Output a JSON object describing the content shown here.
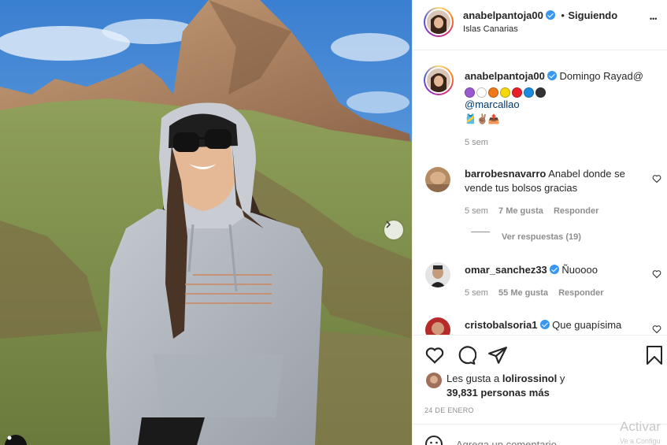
{
  "post": {
    "username": "anabelpantoja00",
    "following_label": "Siguiendo",
    "follow_sep": "•",
    "location": "Islas Canarias",
    "more_label": "•••"
  },
  "caption": {
    "username": "anabelpantoja00",
    "text": "Domingo Rayad@",
    "mention": "@marcallao",
    "emoji_line2": "🎽✌🏽📤",
    "color_circles": [
      "#9b59d0",
      "#ffffff",
      "#f07818",
      "#f5d90c",
      "#e8202a",
      "#1b8ae0",
      "#333333"
    ],
    "time": "5 sem"
  },
  "comments": [
    {
      "username": "barrobesnavarro",
      "text": "Anabel donde se vende tus bolsos gracias",
      "time": "5 sem",
      "likes": "7 Me gusta",
      "reply": "Responder",
      "view_replies": "Ver respuestas (19)"
    },
    {
      "username": "omar_sanchez33",
      "text": "Ñuoooo",
      "time": "5 sem",
      "likes": "55 Me gusta",
      "reply": "Responder"
    },
    {
      "username": "cristobalsoria1",
      "text": "Que guapísima"
    }
  ],
  "likes": {
    "prefix": "Les gusta a",
    "user": "lolirossinol",
    "suffix": "y",
    "others": "39,831 personas más"
  },
  "date": "24 DE ENERO",
  "add_comment_placeholder": "Agrega un comentario...",
  "watermark": {
    "line1": "Activar",
    "line2": "Ve a Configu"
  },
  "icons": {
    "next": "chevron-right-icon",
    "tag": "user-tag-icon",
    "like": "heart-icon",
    "comment": "comment-icon",
    "share": "paper-plane-icon",
    "save": "bookmark-icon",
    "emoji": "smiley-icon",
    "more": "more-dots-icon",
    "verified": "verified-badge-icon"
  },
  "colors": {
    "verified": "#3897f0",
    "text": "#262626",
    "secondary": "#8e8e8e",
    "border": "#efefef"
  }
}
